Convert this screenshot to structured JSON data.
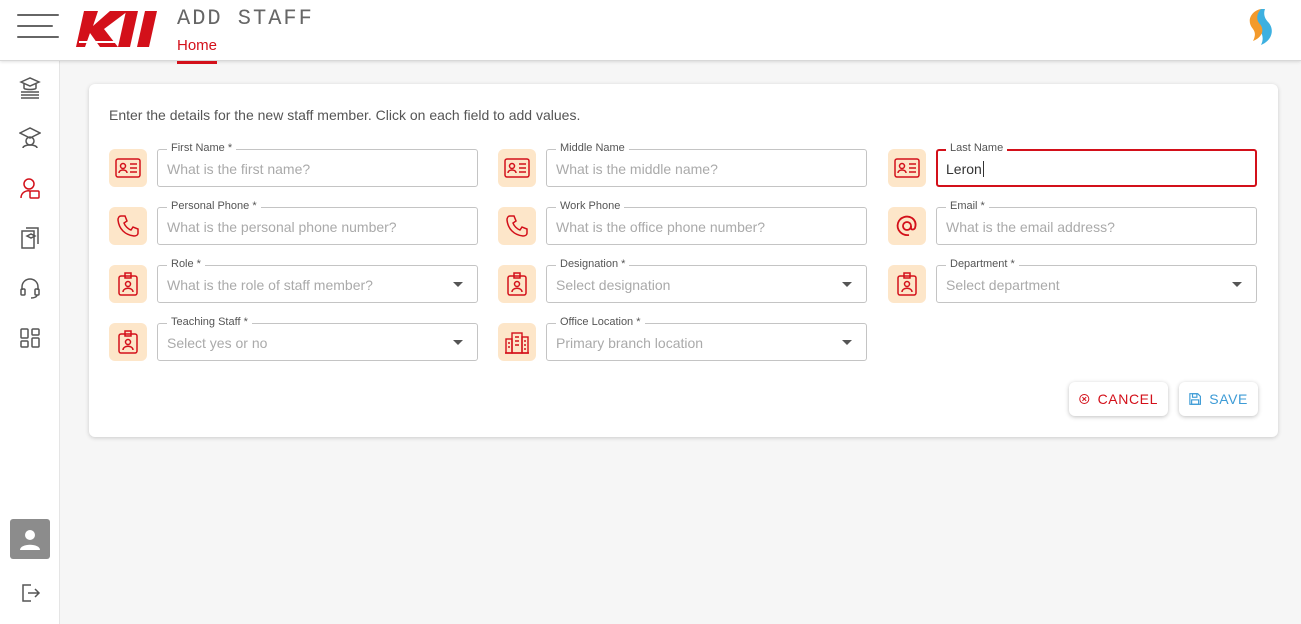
{
  "header": {
    "title": "ADD STAFF",
    "breadcrumb": "Home",
    "logo_text": "KII"
  },
  "sidebar": {
    "items": [
      {
        "name": "courses-icon"
      },
      {
        "name": "students-icon"
      },
      {
        "name": "staff-icon",
        "active": true
      },
      {
        "name": "curriculum-icon"
      },
      {
        "name": "support-icon"
      },
      {
        "name": "dashboard-icon"
      }
    ],
    "logout": "logout-icon"
  },
  "form": {
    "intro": "Enter the details for the new staff member. Click on each field to add values.",
    "fields": [
      {
        "label": "First Name *",
        "placeholder": "What is the first name?",
        "value": "",
        "icon": "id-card-icon"
      },
      {
        "label": "Middle Name",
        "placeholder": "What is the middle name?",
        "value": "",
        "icon": "id-card-icon"
      },
      {
        "label": "Last Name",
        "placeholder": "",
        "value": "Leron",
        "icon": "id-card-icon"
      },
      {
        "label": "Personal Phone *",
        "placeholder": "What is the personal phone number?",
        "value": "",
        "icon": "phone-icon"
      },
      {
        "label": "Work Phone",
        "placeholder": "What is the office phone number?",
        "value": "",
        "icon": "phone-icon"
      },
      {
        "label": "Email *",
        "placeholder": "What is the email address?",
        "value": "",
        "icon": "at-sign-icon"
      },
      {
        "label": "Role *",
        "placeholder": "What is the role of staff member?",
        "value": "",
        "icon": "badge-icon"
      },
      {
        "label": "Designation *",
        "placeholder": "Select designation",
        "value": "",
        "icon": "badge-icon"
      },
      {
        "label": "Department *",
        "placeholder": "Select department",
        "value": "",
        "icon": "badge-icon"
      },
      {
        "label": "Teaching Staff *",
        "placeholder": "Select yes or no",
        "value": "",
        "icon": "badge-icon"
      },
      {
        "label": "Office Location *",
        "placeholder": "Primary branch location",
        "value": "",
        "icon": "building-icon"
      }
    ],
    "cancel_label": "CANCEL",
    "save_label": "SAVE"
  },
  "colors": {
    "accent": "#d3101a",
    "icon_bg": "#fde6c9",
    "save": "#3d9bd6"
  }
}
